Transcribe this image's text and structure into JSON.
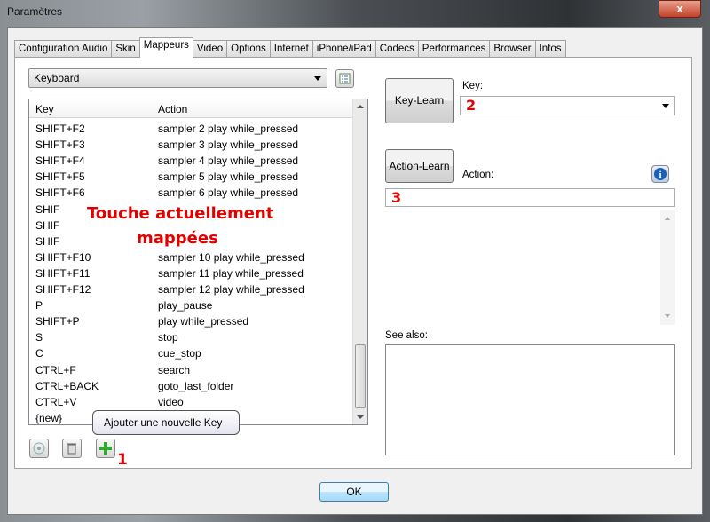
{
  "window": {
    "title": "Paramètres",
    "close_label": "x"
  },
  "tabs": [
    "Configuration Audio",
    "Skin",
    "Mappeurs",
    "Video",
    "Options",
    "Internet",
    "iPhone/iPad",
    "Codecs",
    "Performances",
    "Browser",
    "Infos"
  ],
  "active_tab": "Mappeurs",
  "device_combo": {
    "value": "Keyboard"
  },
  "list": {
    "headers": {
      "key": "Key",
      "action": "Action"
    },
    "rows": [
      {
        "key": "SHIFT+F2",
        "action": "sampler 2 play while_pressed"
      },
      {
        "key": "SHIFT+F3",
        "action": "sampler 3 play while_pressed"
      },
      {
        "key": "SHIFT+F4",
        "action": "sampler 4 play while_pressed"
      },
      {
        "key": "SHIFT+F5",
        "action": "sampler 5 play while_pressed"
      },
      {
        "key": "SHIFT+F6",
        "action": "sampler 6 play while_pressed"
      },
      {
        "key": "SHIF",
        "action": ""
      },
      {
        "key": "SHIF",
        "action": ""
      },
      {
        "key": "SHIF",
        "action": ""
      },
      {
        "key": "SHIFT+F10",
        "action": "sampler 10 play while_pressed"
      },
      {
        "key": "SHIFT+F11",
        "action": "sampler 11 play while_pressed"
      },
      {
        "key": "SHIFT+F12",
        "action": "sampler 12 play while_pressed"
      },
      {
        "key": "P",
        "action": "play_pause"
      },
      {
        "key": "SHIFT+P",
        "action": "play while_pressed"
      },
      {
        "key": "S",
        "action": "stop"
      },
      {
        "key": "C",
        "action": "cue_stop"
      },
      {
        "key": "CTRL+F",
        "action": "search"
      },
      {
        "key": "CTRL+BACK",
        "action": "goto_last_folder"
      },
      {
        "key": "CTRL+V",
        "action": "video"
      },
      {
        "key": "{new}",
        "action": ""
      }
    ]
  },
  "annotations": {
    "overlay_line1": "Touche actuellement",
    "overlay_line2": "mappées",
    "n1": "1",
    "n2": "2",
    "n3": "3"
  },
  "tooltip": "Ajouter une nouvelle Key",
  "right": {
    "key_learn": "Key-Learn",
    "key_label": "Key:",
    "action_learn": "Action-Learn",
    "action_label": "Action:",
    "see_also": "See also:"
  },
  "ok_label": "OK"
}
